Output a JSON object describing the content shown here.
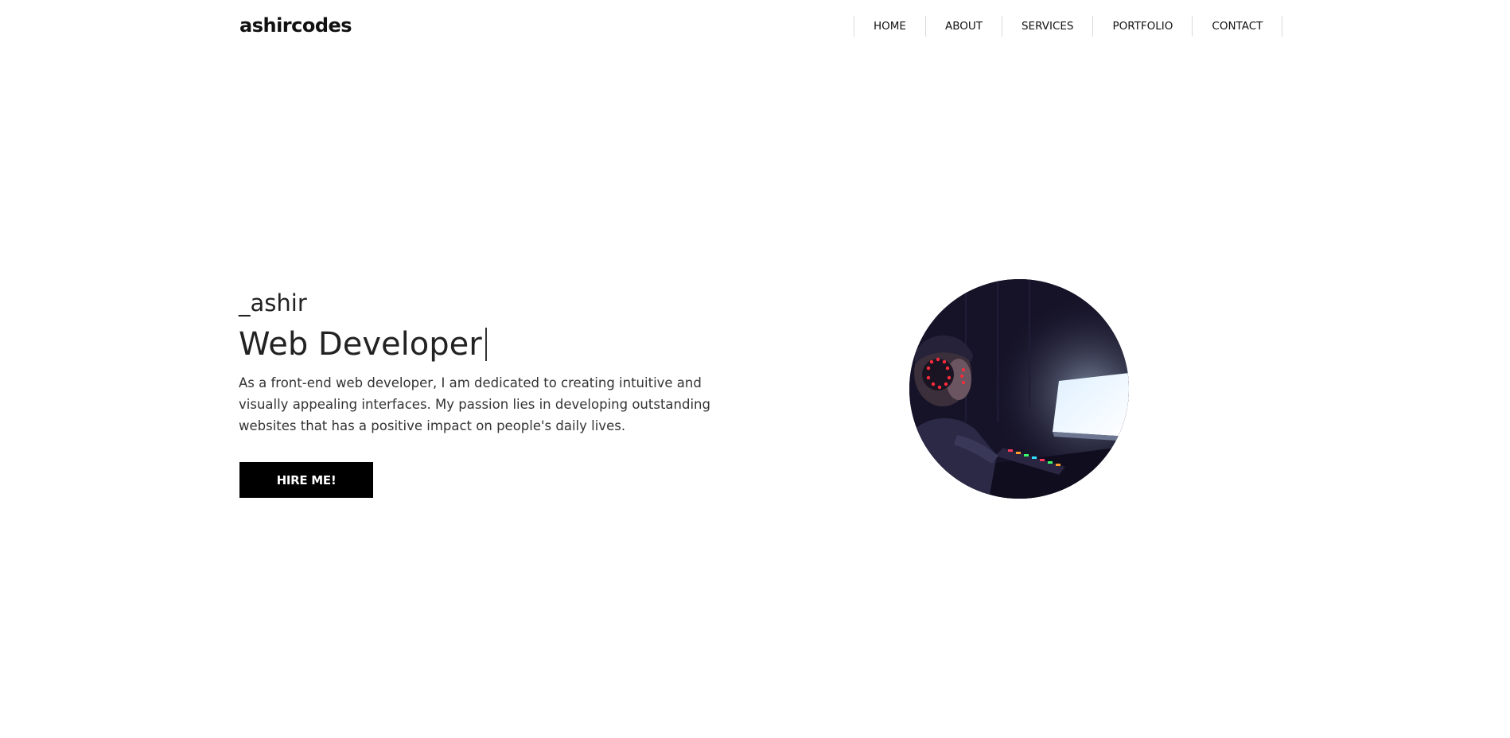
{
  "header": {
    "logo": "ashircodes",
    "nav": [
      {
        "label": "HOME"
      },
      {
        "label": "ABOUT"
      },
      {
        "label": "SERVICES"
      },
      {
        "label": "PORTFOLIO"
      },
      {
        "label": "CONTACT"
      }
    ]
  },
  "hero": {
    "handle": "_ashir",
    "role": "Web Developer",
    "description": "As a front-end web developer, I am dedicated to creating intuitive and visually appealing interfaces. My passion lies in developing outstanding websites that has a positive impact on people's daily lives.",
    "cta_label": "HIRE ME!"
  },
  "colors": {
    "accent": "#000000",
    "headset_led": "#ff2b3a",
    "monitor_glow": "#e8f4ff"
  },
  "icons": {
    "portrait": "developer-at-computer-photo"
  }
}
